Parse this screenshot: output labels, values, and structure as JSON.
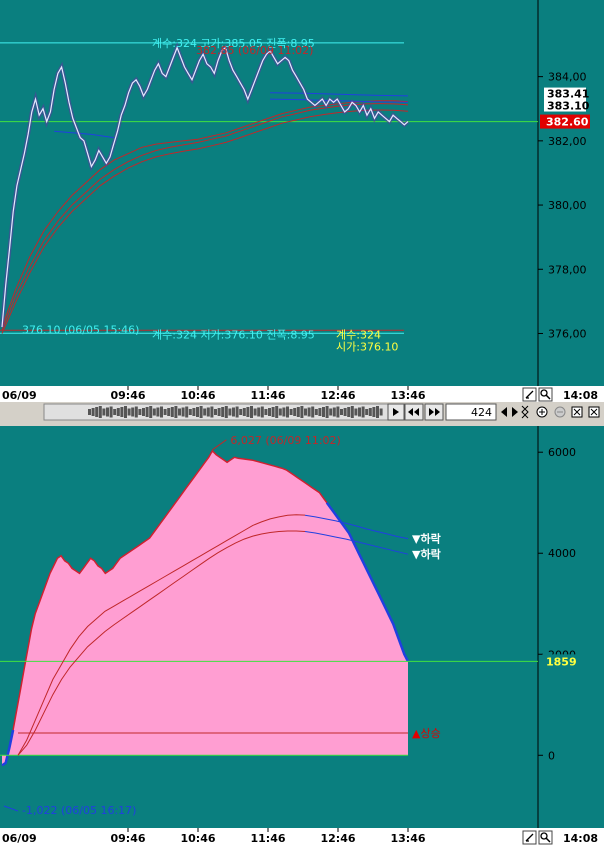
{
  "colors": {
    "plot_bg": "#0a7f7f",
    "axis_bg": "#0a7f7f",
    "price_line": "#e8e8ff",
    "ma_red": "#c0282a",
    "ma_blue": "#2040e0",
    "hline_cyan": "#40f0f0",
    "hline_green": "#40e040",
    "fill_pink": "#ff9ed2",
    "fill_edge": "#d02030",
    "label_yellow": "#ffff40",
    "last_price_bg": "#e00000"
  },
  "time_axis": {
    "left_label": "06/09",
    "right_label": "14:08",
    "ticks": [
      "09:46",
      "10:46",
      "11:46",
      "12:46",
      "13:46"
    ]
  },
  "scroll": {
    "value": "424"
  },
  "icons": [
    "draw-icon",
    "magnifier-icon",
    "scroll-right-icon",
    "rewind-icon",
    "fast-forward-icon",
    "play-back-icon",
    "play-forward-icon",
    "zoom-in-icon",
    "zoom-out-icon",
    "fit-icon",
    "close-icon"
  ],
  "chart_data": [
    {
      "type": "line",
      "ylim": [
        374.8,
        386.2
      ],
      "y_ticks": [
        "384,00",
        "382,00",
        "380,00",
        "378,00",
        "376,00"
      ],
      "y_tick_values": [
        384,
        382,
        380,
        378,
        376
      ],
      "x_tick_index": [
        48,
        108,
        168,
        228,
        288,
        348
      ],
      "series": [
        {
          "values": [
            376.2,
            377.5,
            378.6,
            379.8,
            380.6,
            381.1,
            381.6,
            382.2,
            382.9,
            383.3,
            382.8,
            383.0,
            382.6,
            382.9,
            383.6,
            384.1,
            384.3,
            383.8,
            383.2,
            382.7,
            382.4,
            382.1,
            382.0,
            381.6,
            381.2,
            381.4,
            381.7,
            381.5,
            381.3,
            381.5,
            381.9,
            382.3,
            382.8,
            383.1,
            383.5,
            383.8,
            383.9,
            383.7,
            383.4,
            383.6,
            383.9,
            384.2,
            384.4,
            384.1,
            384.0,
            384.3,
            384.6,
            384.9,
            384.6,
            384.3,
            384.1,
            383.9,
            384.2,
            384.5,
            384.7,
            384.4,
            384.3,
            384.1,
            384.5,
            384.8,
            384.9,
            384.5,
            384.2,
            384.0,
            383.8,
            383.6,
            383.3,
            383.6,
            383.9,
            384.2,
            384.5,
            384.7,
            384.8,
            384.6,
            384.4,
            384.5,
            384.6,
            384.5,
            384.2,
            384.0,
            383.8,
            383.6,
            383.3,
            383.2,
            383.1,
            383.2,
            383.3,
            383.1,
            383.3,
            383.2,
            383.3,
            383.1,
            382.9,
            383.0,
            383.2,
            383.1,
            382.9,
            383.1,
            382.8,
            383.0,
            382.7,
            382.9,
            382.8,
            382.7,
            382.6,
            382.8,
            382.7,
            382.6,
            382.5,
            382.6
          ],
          "open": 376.1,
          "high": 385.05,
          "low": 376.1,
          "count": 324
        }
      ],
      "moving_averages": {
        "red": [
          [
            376.2,
            377.4,
            378.4,
            379.2,
            379.8,
            380.3,
            380.7,
            381.1,
            381.4,
            381.6,
            381.8,
            381.9,
            381.95,
            382.0,
            382.05,
            382.15,
            382.25,
            382.4,
            382.55,
            382.7,
            382.85,
            382.95,
            383.05,
            383.1,
            383.15,
            383.2,
            383.23,
            383.25,
            383.25,
            383.22
          ],
          [
            376.1,
            377.2,
            378.1,
            378.9,
            379.5,
            380.0,
            380.4,
            380.8,
            381.1,
            381.35,
            381.55,
            381.7,
            381.8,
            381.88,
            381.95,
            382.05,
            382.15,
            382.3,
            382.45,
            382.6,
            382.75,
            382.85,
            382.95,
            383.02,
            383.08,
            383.12,
            383.15,
            383.16,
            383.15,
            383.12
          ],
          [
            376.0,
            377.0,
            377.9,
            378.7,
            379.3,
            379.8,
            380.2,
            380.6,
            380.9,
            381.15,
            381.35,
            381.5,
            381.6,
            381.68,
            381.75,
            381.85,
            381.95,
            382.1,
            382.25,
            382.4,
            382.55,
            382.65,
            382.75,
            382.82,
            382.88,
            382.92,
            382.95,
            382.96,
            382.95,
            382.92
          ]
        ],
        "blue": [
          [
            383.5,
            383.48,
            383.45,
            383.42,
            383.4
          ],
          [
            383.3,
            383.28,
            383.25,
            383.22,
            383.2
          ]
        ]
      },
      "hlines": [
        385.05,
        382.6,
        376.1
      ],
      "annotations": {
        "high_text": "계수:324 고가:385.05 진폭:8.95",
        "high_overlay": "382.85 (06/09 11:02)",
        "low_text": "376.10 (06/05 15:46)",
        "low_stats": "계수:324 저가:376.10 진폭:8.95",
        "low_box_1": "계수:324",
        "low_box_2": "시가:376.10"
      },
      "right_tags": {
        "ma_a": "383.41",
        "ma_b": "383.10",
        "last": "382.60"
      }
    },
    {
      "type": "area",
      "ylim": [
        -1400,
        6400
      ],
      "y_ticks": [
        "6000",
        "4000",
        "2000",
        "0"
      ],
      "y_tick_values": [
        6000,
        4000,
        2000,
        0
      ],
      "x_tick_index": [
        48,
        108,
        168,
        228,
        288,
        348
      ],
      "series": [
        {
          "values": [
            -200,
            -150,
            150,
            500,
            900,
            1300,
            1700,
            2100,
            2500,
            2800,
            3000,
            3200,
            3400,
            3600,
            3750,
            3900,
            3950,
            3850,
            3800,
            3700,
            3650,
            3600,
            3700,
            3800,
            3900,
            3850,
            3750,
            3700,
            3600,
            3650,
            3700,
            3800,
            3900,
            3950,
            4000,
            4050,
            4100,
            4150,
            4200,
            4250,
            4300,
            4400,
            4500,
            4600,
            4700,
            4800,
            4900,
            5000,
            5100,
            5200,
            5300,
            5400,
            5500,
            5600,
            5700,
            5800,
            5900,
            6027,
            5950,
            5900,
            5850,
            5800,
            5850,
            5900,
            5880,
            5870,
            5860,
            5850,
            5840,
            5820,
            5800,
            5780,
            5760,
            5740,
            5720,
            5700,
            5680,
            5650,
            5600,
            5550,
            5500,
            5450,
            5400,
            5350,
            5300,
            5250,
            5200,
            5100,
            5000,
            4900,
            4800,
            4700,
            4600,
            4500,
            4400,
            4250,
            4100,
            3950,
            3800,
            3650,
            3500,
            3350,
            3200,
            3050,
            2900,
            2750,
            2600,
            2400,
            2200,
            2000,
            1859
          ]
        }
      ],
      "curves": {
        "red_1": [
          0,
          300,
          700,
          1100,
          1500,
          1800,
          2100,
          2350,
          2550,
          2700,
          2850,
          2950,
          3050,
          3150,
          3250,
          3350,
          3450,
          3550,
          3650,
          3750,
          3850,
          3950,
          4050,
          4150,
          4250,
          4350,
          4450,
          4550,
          4620,
          4680,
          4720,
          4750,
          4760,
          4755
        ],
        "red_2": [
          0,
          200,
          500,
          850,
          1200,
          1500,
          1750,
          1950,
          2150,
          2300,
          2450,
          2580,
          2700,
          2820,
          2940,
          3060,
          3180,
          3300,
          3420,
          3540,
          3660,
          3780,
          3900,
          4010,
          4110,
          4200,
          4280,
          4340,
          4380,
          4410,
          4430,
          4440,
          4440,
          4430
        ],
        "blue_1": [
          4750,
          4720,
          4680,
          4640,
          4590,
          4540,
          4480,
          4430,
          4380,
          4330,
          4290
        ],
        "blue_2": [
          4430,
          4400,
          4360,
          4320,
          4280,
          4230,
          4180,
          4130,
          4080,
          4030,
          3980
        ]
      },
      "hlines": [
        1859,
        0,
        440
      ],
      "annotations": {
        "high_text": "6,027 (06/09 11:02)",
        "low_text": "-1,022 (06/05 16:17)",
        "blue_1_label": "▼하락",
        "blue_2_label": "▼하락",
        "red_flat_label": "▲상승"
      },
      "right_tags": {
        "last": "1859"
      }
    }
  ]
}
